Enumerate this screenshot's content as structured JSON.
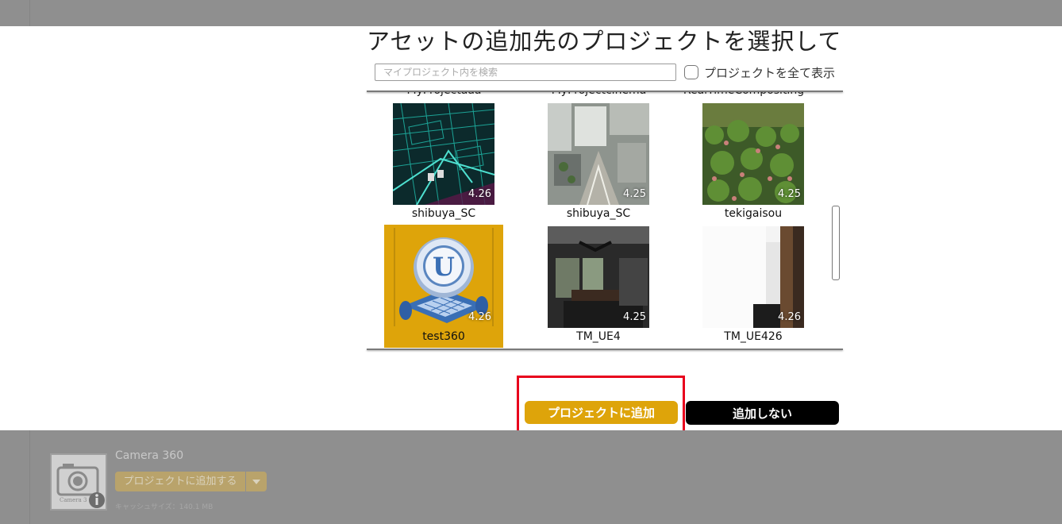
{
  "dialog": {
    "title": "アセットの追加先のプロジェクトを選択してください",
    "search_placeholder": "マイプロジェクト内を検索",
    "show_all_label": "プロジェクトを全て表示",
    "partial_row_labels": [
      "MyProjectaaa",
      "MyProjectcinema",
      "RealTimeCompositing"
    ],
    "projects": [
      {
        "name": "shibuya_SC",
        "version": "4.26",
        "thumb": "green-wireframe-city",
        "selected": false
      },
      {
        "name": "shibuya_SC",
        "version": "4.25",
        "thumb": "aerial-city-photo",
        "selected": false
      },
      {
        "name": "tekigaisou",
        "version": "4.25",
        "thumb": "green-foliage",
        "selected": false
      },
      {
        "name": "test360",
        "version": "4.26",
        "thumb": "unreal-engine-icon",
        "selected": true
      },
      {
        "name": "TM_UE4",
        "version": "4.25",
        "thumb": "dark-interior",
        "selected": false
      },
      {
        "name": "TM_UE426",
        "version": "4.26",
        "thumb": "white-interior",
        "selected": false
      }
    ],
    "add_button_label": "プロジェクトに追加",
    "cancel_button_label": "追加しない",
    "highlight_color": "#e8001c",
    "accent_color": "#dea40a"
  },
  "asset": {
    "name": "Camera 360",
    "icon": "camera-icon",
    "icon_caption": "Camera 3",
    "add_label": "プロジェクトに追加する",
    "cache_size": "キャッシュサイズ：140.1 MB"
  }
}
